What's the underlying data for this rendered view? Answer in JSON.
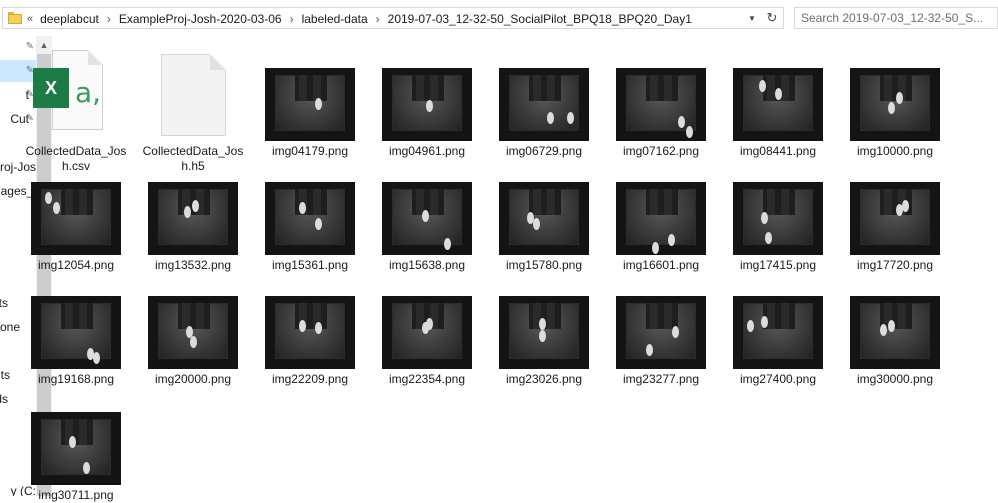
{
  "address_bar": {
    "overflow": "«",
    "breadcrumbs": [
      "deeplabcut",
      "ExampleProj-Josh-2020-03-06",
      "labeled-data",
      "2019-07-03_12-32-50_SocialPilot_BPQ18_BPQ20_Day1"
    ]
  },
  "search": {
    "placeholder": "Search 2019-07-03_12-32-50_S..."
  },
  "nav_pane": {
    "items": [
      {
        "label": "",
        "selected": true
      },
      {
        "label": "t",
        "selected": false
      },
      {
        "label": "Cut",
        "selected": false
      }
    ],
    "texts": [
      "roj-Jos",
      "nages_l",
      "ts",
      "one",
      "ts",
      "ds",
      "y (C:)"
    ]
  },
  "files": [
    {
      "name": "CollectedData_Josh.csv",
      "type": "csv"
    },
    {
      "name": "CollectedData_Josh.h5",
      "type": "h5"
    },
    {
      "name": "img04179.png",
      "type": "png"
    },
    {
      "name": "img04961.png",
      "type": "png"
    },
    {
      "name": "img06729.png",
      "type": "png"
    },
    {
      "name": "img07162.png",
      "type": "png"
    },
    {
      "name": "img08441.png",
      "type": "png"
    },
    {
      "name": "img10000.png",
      "type": "png"
    },
    {
      "name": "img12054.png",
      "type": "png"
    },
    {
      "name": "img13532.png",
      "type": "png"
    },
    {
      "name": "img15361.png",
      "type": "png"
    },
    {
      "name": "img15638.png",
      "type": "png"
    },
    {
      "name": "img15780.png",
      "type": "png"
    },
    {
      "name": "img16601.png",
      "type": "png"
    },
    {
      "name": "img17415.png",
      "type": "png"
    },
    {
      "name": "img17720.png",
      "type": "png"
    },
    {
      "name": "img19168.png",
      "type": "png"
    },
    {
      "name": "img20000.png",
      "type": "png"
    },
    {
      "name": "img22209.png",
      "type": "png"
    },
    {
      "name": "img22354.png",
      "type": "png"
    },
    {
      "name": "img23026.png",
      "type": "png"
    },
    {
      "name": "img23277.png",
      "type": "png"
    },
    {
      "name": "img27400.png",
      "type": "png"
    },
    {
      "name": "img30000.png",
      "type": "png"
    },
    {
      "name": "img30711.png",
      "type": "png"
    }
  ],
  "icons": {
    "address_folder": "folder-icon",
    "address_dropdown": "chevron-down-icon",
    "address_refresh": "refresh-icon",
    "nav_pin": "pin-icon",
    "scroll_up": "chevron-up-icon",
    "csv": "excel-csv-icon",
    "h5": "blank-file-icon"
  },
  "colors": {
    "selection": "#cce8ff",
    "excel_green": "#1d7b45"
  }
}
